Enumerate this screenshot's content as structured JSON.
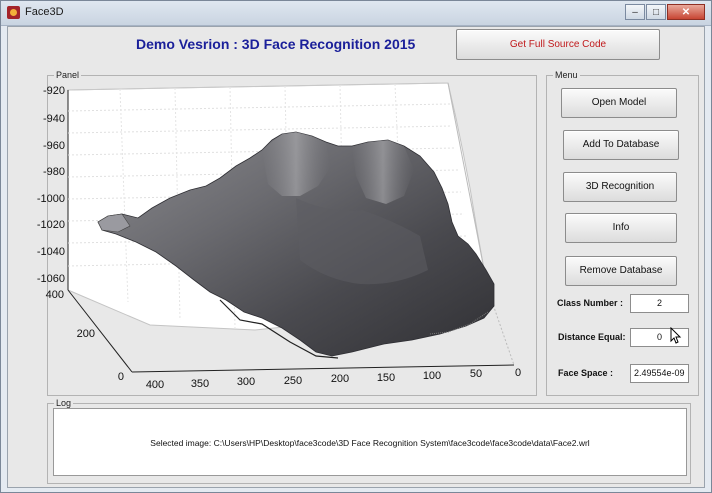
{
  "window": {
    "title": "Face3D",
    "buttons": {
      "minimize": "–",
      "maximize": "□",
      "close": "✕"
    },
    "close_color": "#c74533"
  },
  "header": {
    "title": "Demo Vesrion : 3D Face Recognition 2015",
    "title_color": "#1a1f9a",
    "source_button": "Get Full Source Code",
    "source_button_color": "#c0191b"
  },
  "panel": {
    "legend": "Panel",
    "z_ticks": [
      "-920",
      "-940",
      "-960",
      "-980",
      "-1000",
      "-1020",
      "-1040",
      "-1060"
    ],
    "y_ticks": [
      "400",
      "200",
      "0"
    ],
    "x_ticks": [
      "400",
      "350",
      "300",
      "250",
      "200",
      "150",
      "100",
      "50",
      "0"
    ]
  },
  "menu": {
    "legend": "Menu",
    "buttons": [
      "Open Model",
      "Add To Database",
      "3D Recognition",
      "Info",
      "Remove Database"
    ],
    "fields": {
      "class_number": {
        "label": "Class Number :",
        "value": "2"
      },
      "distance_equal": {
        "label": "Distance Equal:",
        "value": "0"
      },
      "face_space": {
        "label": "Face Space :",
        "value": "2.49554e-09"
      }
    }
  },
  "log": {
    "legend": "Log",
    "text": "Selected image: C:\\Users\\HP\\Desktop\\face3code\\3D Face Recognition System\\face3code\\face3code\\data\\Face2.wrl"
  }
}
